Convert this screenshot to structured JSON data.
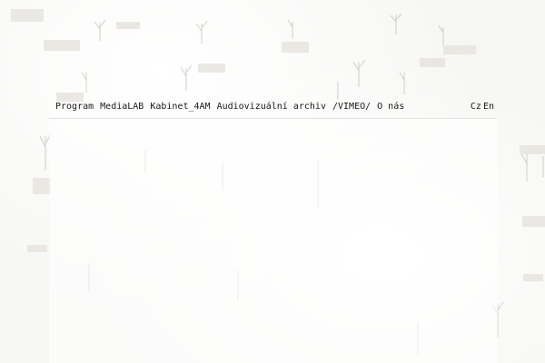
{
  "nav": {
    "items": [
      {
        "label": "Program"
      },
      {
        "label": "MediaLAB"
      },
      {
        "label": "Kabinet_4AM"
      },
      {
        "label": "Audiovizuální archiv"
      },
      {
        "label": "/VIMEO/"
      },
      {
        "label": "O nás"
      }
    ],
    "languages": {
      "cz": "Cz",
      "en": "En"
    }
  },
  "colors": {
    "background": "#f7f7f5",
    "text": "#1a1a1a",
    "divider": "#e2e2e2"
  }
}
